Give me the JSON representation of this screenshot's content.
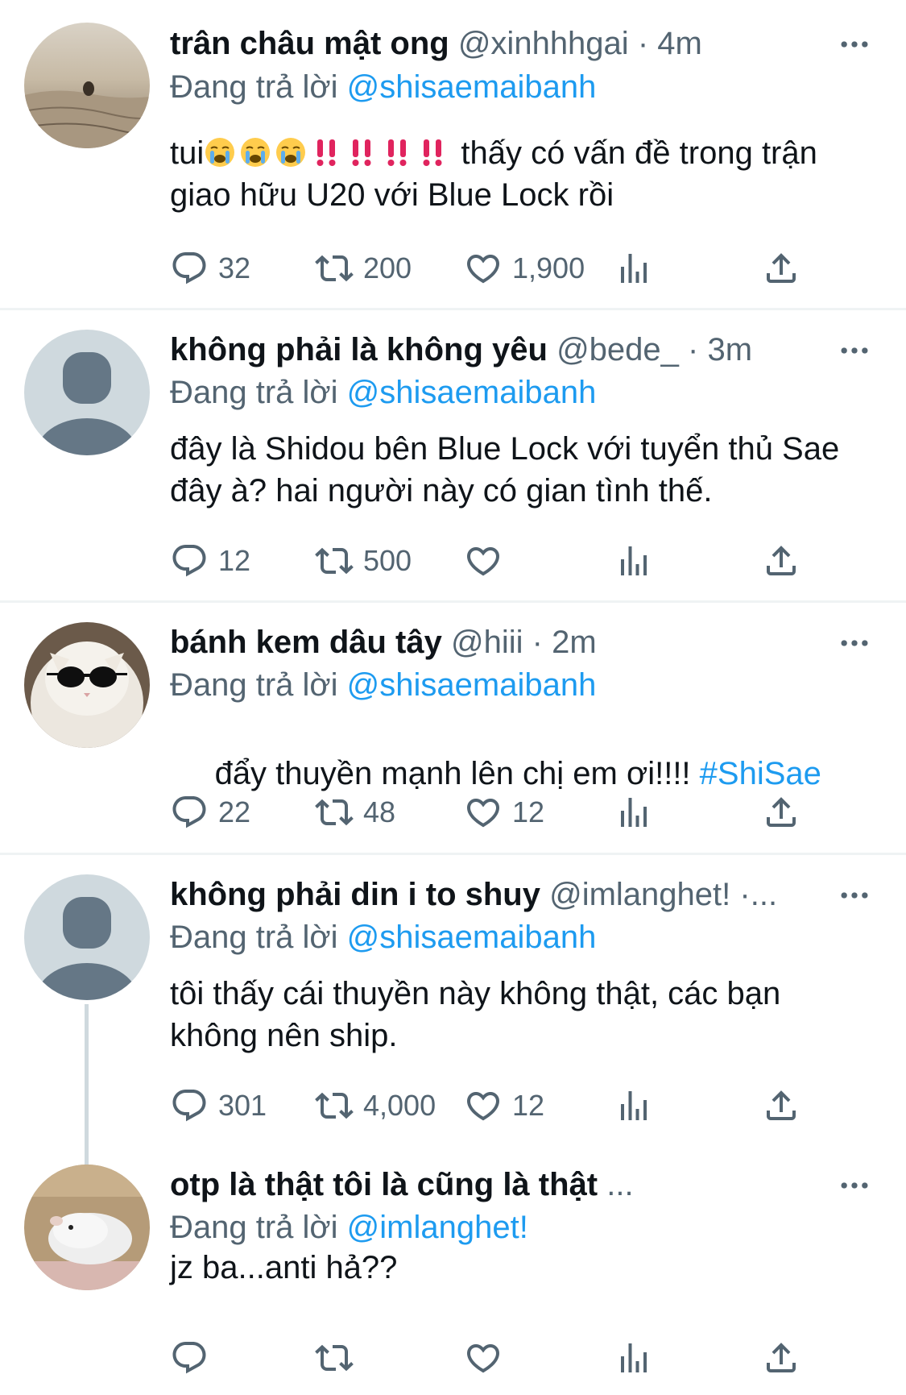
{
  "colors": {
    "accent": "#1d9bf0",
    "muted": "#536471",
    "text": "#0f1419",
    "divider": "#eff3f4",
    "emoji_red": "#e0245e"
  },
  "labels": {
    "replying_to": "Đang trả lời"
  },
  "tweets": [
    {
      "display_name": "trân châu mật ong",
      "handle": "@xinhhhgai",
      "separator": "·",
      "time": "4m",
      "reply_to": "@shisaemaibanh",
      "text_lead": "tui",
      "emojis": [
        "loudly-crying-face",
        "loudly-crying-face",
        "loudly-crying-face",
        "double-exclamation",
        "double-exclamation",
        "double-exclamation",
        "double-exclamation"
      ],
      "text": " thấy có vấn đề trong trận giao hữu U20 với Blue Lock rồi",
      "replies": "32",
      "retweets": "200",
      "likes": "1,900",
      "avatar": "desert-photo"
    },
    {
      "display_name": "không phải là không yêu",
      "handle": "@bede_",
      "separator": "·",
      "time": "3m",
      "reply_to": "@shisaemaibanh",
      "text": "đây là Shidou bên Blue Lock với tuyển thủ Sae đây à? hai người này có gian tình thế.",
      "replies": "12",
      "retweets": "500",
      "likes": "",
      "avatar": "default-profile"
    },
    {
      "display_name": "bánh kem dâu tây",
      "handle": "@hiii",
      "separator": "·",
      "time": "2m",
      "reply_to": "@shisaemaibanh",
      "text": " đẩy thuyền mạnh lên chị em ơi!!!! ",
      "hashtag": "#ShiSae",
      "replies": "22",
      "retweets": "48",
      "likes": "12",
      "avatar": "cat-sunglasses-photo"
    },
    {
      "display_name": "không phải din i to shuy",
      "handle": "@imlanghet!",
      "separator": "·...",
      "time": "",
      "reply_to": "@shisaemaibanh",
      "text": "tôi thấy cái thuyền này không thật, các bạn không nên ship.",
      "replies": "301",
      "retweets": "4,000",
      "likes": "12",
      "avatar": "default-profile"
    },
    {
      "display_name": "otp là thật tôi là cũng là thật",
      "handle": "...",
      "separator": "",
      "time": "",
      "reply_to": "@imlanghet!",
      "text": "jz ba...anti hả??",
      "replies": "",
      "retweets": "",
      "likes": "",
      "avatar": "hamster-photo"
    }
  ]
}
